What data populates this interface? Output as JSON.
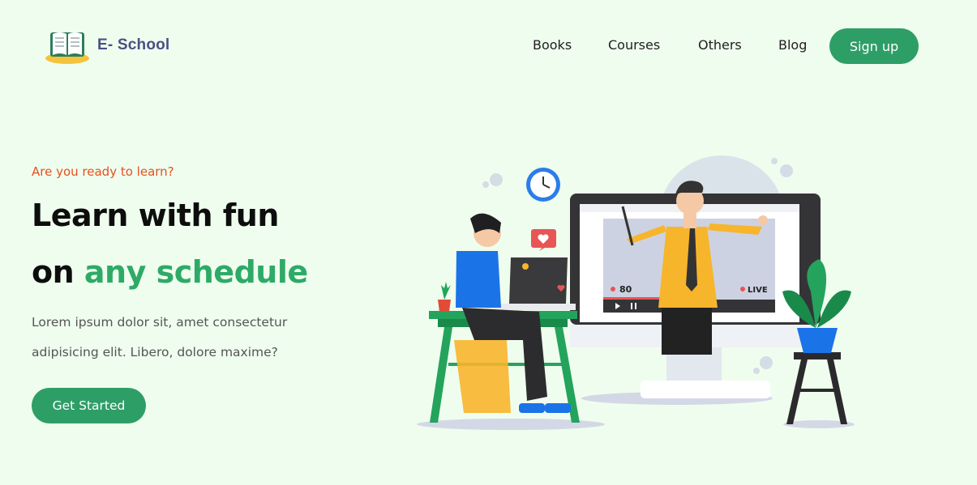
{
  "brand": {
    "name": "E- School",
    "logo_icon": "open-book-icon"
  },
  "nav": {
    "items": [
      "Books",
      "Courses",
      "Others",
      "Blog"
    ],
    "signup_label": "Sign up"
  },
  "hero": {
    "eyebrow": "Are you ready to learn?",
    "title_line1": "Learn with fun",
    "title_line2_prefix": "on",
    "title_line2_accent": "any schedule",
    "lead_line1": "Lorem ipsum dolor sit, amet consectetur",
    "lead_line2": "adipisicing elit. Libero, dolore maxime?",
    "cta_label": "Get Started"
  },
  "illustration": {
    "viewer_count": "80",
    "live_label": "LIVE"
  },
  "colors": {
    "background": "#effdee",
    "primary": "#2e9e67",
    "accent_text": "#2eaa67",
    "eyebrow": "#e8501e",
    "brand_text": "#4b4f86"
  }
}
